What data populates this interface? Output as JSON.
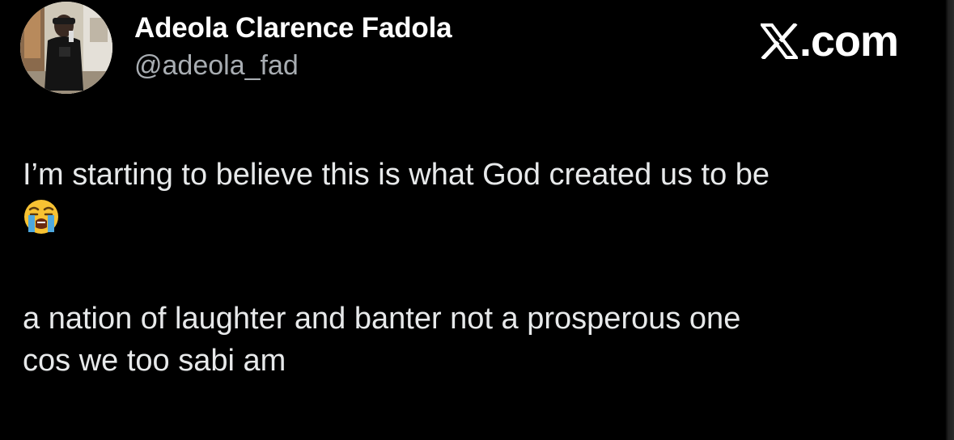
{
  "author": {
    "display_name": "Adeola Clarence Fadola",
    "handle": "@adeola_fad"
  },
  "brand": {
    "text": ".com",
    "icon": "x-logo-icon"
  },
  "tweet": {
    "line1": "I’m starting to believe this is what God created us to be",
    "emoji": "loudly-crying-face-icon",
    "line2": "a nation of laughter and banter not a prosperous one",
    "line3": "cos we too sabi am"
  },
  "colors": {
    "background": "#000000",
    "primary_text": "#e7e9ea",
    "secondary_text": "#a8adb2",
    "emoji_face": "#f7c233",
    "tears": "#4ea8de"
  }
}
